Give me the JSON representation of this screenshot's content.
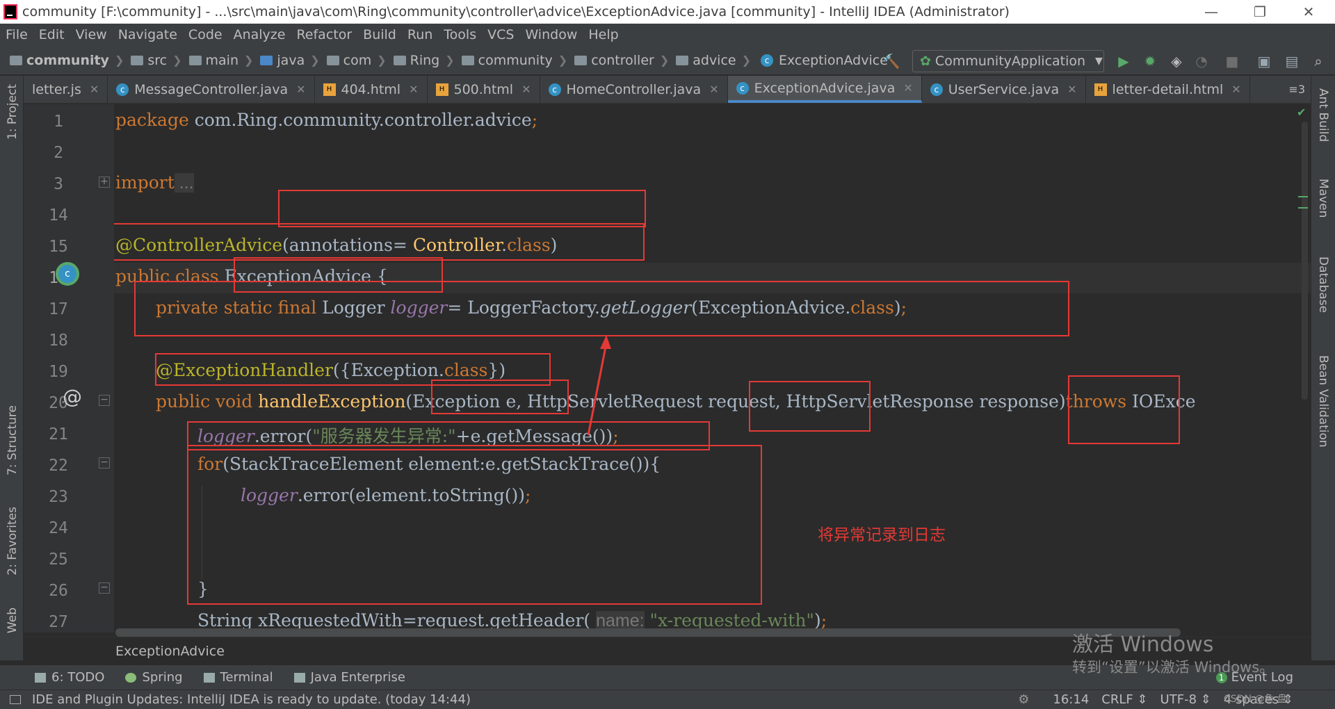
{
  "window": {
    "title": "community [F:\\community] - ...\\src\\main\\java\\com\\Ring\\community\\controller\\advice\\ExceptionAdvice.java [community] - IntelliJ IDEA (Administrator)",
    "minimize": "—",
    "restore": "❐",
    "close": "✕"
  },
  "menu": [
    "File",
    "Edit",
    "View",
    "Navigate",
    "Code",
    "Analyze",
    "Refactor",
    "Build",
    "Run",
    "Tools",
    "VCS",
    "Window",
    "Help"
  ],
  "breadcrumbs": {
    "project": "community",
    "items": [
      "src",
      "main",
      "java",
      "com",
      "Ring",
      "community",
      "controller",
      "advice"
    ],
    "file": "ExceptionAdvice"
  },
  "run_config": {
    "label": "CommunityApplication"
  },
  "tabs": [
    {
      "label": "letter.js",
      "icon": "js-icon"
    },
    {
      "label": "MessageController.java",
      "icon": "class-icon"
    },
    {
      "label": "404.html",
      "icon": "html-icon"
    },
    {
      "label": "500.html",
      "icon": "html-icon"
    },
    {
      "label": "HomeController.java",
      "icon": "class-icon"
    },
    {
      "label": "ExceptionAdvice.java",
      "icon": "class-icon",
      "active": true
    },
    {
      "label": "UserService.java",
      "icon": "class-icon"
    },
    {
      "label": "letter-detail.html",
      "icon": "html-icon"
    }
  ],
  "tabs_overflow": "≡3",
  "left_tools": {
    "project": "1: Project",
    "structure": "7: Structure",
    "favorites": "2: Favorites",
    "web": "Web"
  },
  "right_tools": {
    "ant": "Ant Build",
    "maven": "Maven",
    "database": "Database",
    "bean": "Bean Validation"
  },
  "line_numbers": [
    "1",
    "2",
    "3",
    "14",
    "15",
    "16",
    "17",
    "18",
    "19",
    "20",
    "21",
    "22",
    "23",
    "24",
    "25",
    "26",
    "27"
  ],
  "code": {
    "l1_kw": "package",
    "l1_rest": " com.Ring.community.controller.advice",
    "l1_semi": ";",
    "l3_kw": "import",
    "l3_fold": " ...",
    "l15_ann": "@ControllerAdvice",
    "l15_p1": "(annotations= ",
    "l15_cls": "Controller",
    "l15_dot": ".",
    "l15_kw": "class",
    "l15_p2": ")",
    "l16_kw": "public class ",
    "l16_name": "ExceptionAdvice",
    "l16_brace": " {",
    "l17_kw": "private static final ",
    "l17_type": "Logger ",
    "l17_fld": "logger",
    "l17_eq": "= LoggerFactory.",
    "l17_call": "getLogger",
    "l17_arg": "(ExceptionAdvice.",
    "l17_kw2": "class",
    "l17_end": ")",
    "l17_semi": ";",
    "l19_ann": "@ExceptionHandler",
    "l19_p1": "({Exception.",
    "l19_kw": "class",
    "l19_p2": "})",
    "l20_kw": "public void ",
    "l20_fn": "handleException",
    "l20_params": "(Exception e, HttpServletRequest request, HttpServletResponse response)",
    "l20_throws": "throws ",
    "l20_exc": "IOExce",
    "l21_fld": "logger",
    "l21_call": ".error(",
    "l21_str": "\"服务器发生异常:\"",
    "l21_rest": "+e.getMessage())",
    "l21_semi": ";",
    "l22_kw": "for",
    "l22_rest": "(StackTraceElement element:e.getStackTrace()){",
    "l23_fld": "logger",
    "l23_rest": ".error(element.toString())",
    "l23_semi": ";",
    "l26": "}",
    "l27_a": "String xRequestedWith=request.getHeader( ",
    "l27_hint": "name:",
    "l27_str": " \"x-requested-with\"",
    "l27_end": ")",
    "l27_semi": ";"
  },
  "annotation_note": "将异常记录到日志",
  "bottom_breadcrumb": "ExceptionAdvice",
  "bottom_tools": [
    "6: TODO",
    "Spring",
    "Terminal",
    "Java Enterprise"
  ],
  "event_log": {
    "count": "1",
    "label": "Event Log"
  },
  "status": {
    "message": "IDE and Plugin Updates: IntelliJ IDEA is ready to update. (today 14:44)",
    "position": "16:14",
    "line_sep": "CRLF ⇕",
    "encoding": "UTF-8 ⇕",
    "indent": "4 spaces ⇕"
  },
  "watermark": {
    "line1": "激活 Windows",
    "line2": "转到“设置”以激活 Windows。",
    "csdn": "CSDN @鱼 盘"
  },
  "colors": {
    "keyword": "#cc7832",
    "annotation": "#bbb529",
    "string": "#6a8759",
    "field": "#9876aa",
    "method": "#ffc66d",
    "red_markup": "#e53935"
  }
}
